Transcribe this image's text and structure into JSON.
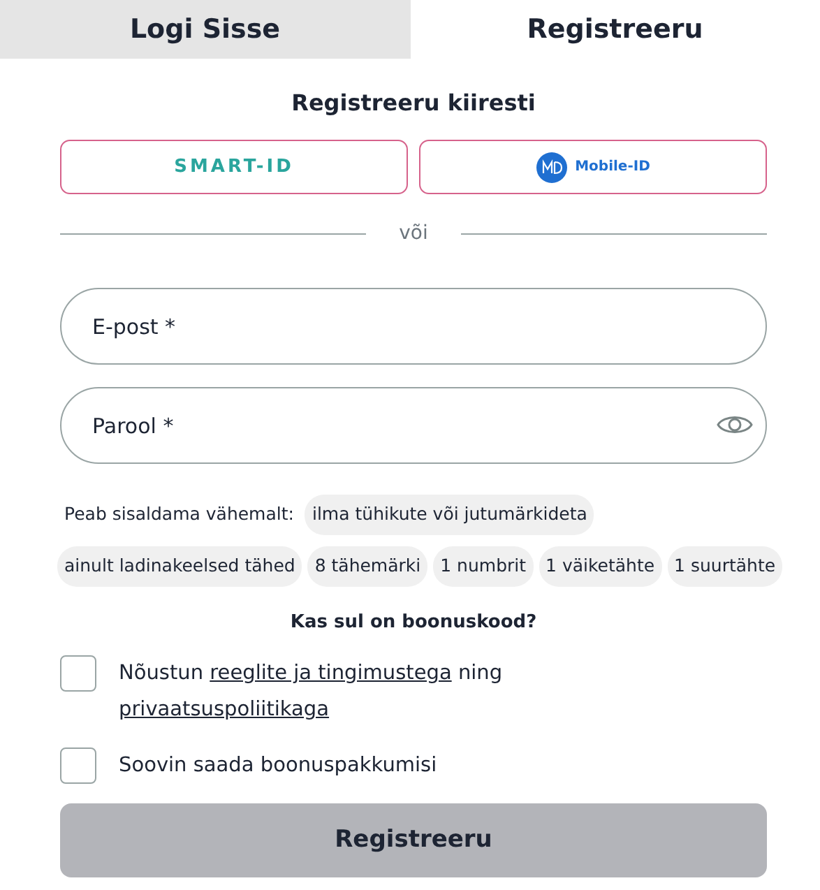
{
  "tabs": [
    {
      "label": "Logi Sisse",
      "selected": false
    },
    {
      "label": "Registreeru",
      "selected": true
    }
  ],
  "quick_title": "Registreeru kiiresti",
  "quick_buttons": [
    {
      "kind": "smart-id",
      "label": "SMART-ID"
    },
    {
      "kind": "mobile-id",
      "label": "Mobile-ID"
    }
  ],
  "divider_text": "või",
  "fields": [
    {
      "kind": "email",
      "placeholder": "E-post *"
    },
    {
      "kind": "password",
      "placeholder": "Parool *"
    }
  ],
  "rules_label": "Peab sisaldama vähemalt:",
  "rules": [
    "ilma tühikute või jutumärkideta",
    "ainult ladinakeelsed tähed",
    "8 tähemärki",
    "1 numbrit",
    "1 väiketähte",
    "1 suurtähte"
  ],
  "bonus_link": "Kas sul on boonuskood?",
  "checkboxes": [
    {
      "checked": false,
      "parts": [
        {
          "kind": "text",
          "text": "Nõustun"
        },
        {
          "kind": "link",
          "text": "reeglite ja tingimustega"
        },
        {
          "kind": "text",
          "text": "ning"
        },
        {
          "kind": "link",
          "text": "privaatsuspoliitikaga"
        }
      ]
    },
    {
      "checked": false,
      "parts": [
        {
          "kind": "text",
          "text": "Soovin saada boonuspakkumisi"
        }
      ]
    }
  ],
  "submit": {
    "label": "Registreeru",
    "disabled": true
  }
}
